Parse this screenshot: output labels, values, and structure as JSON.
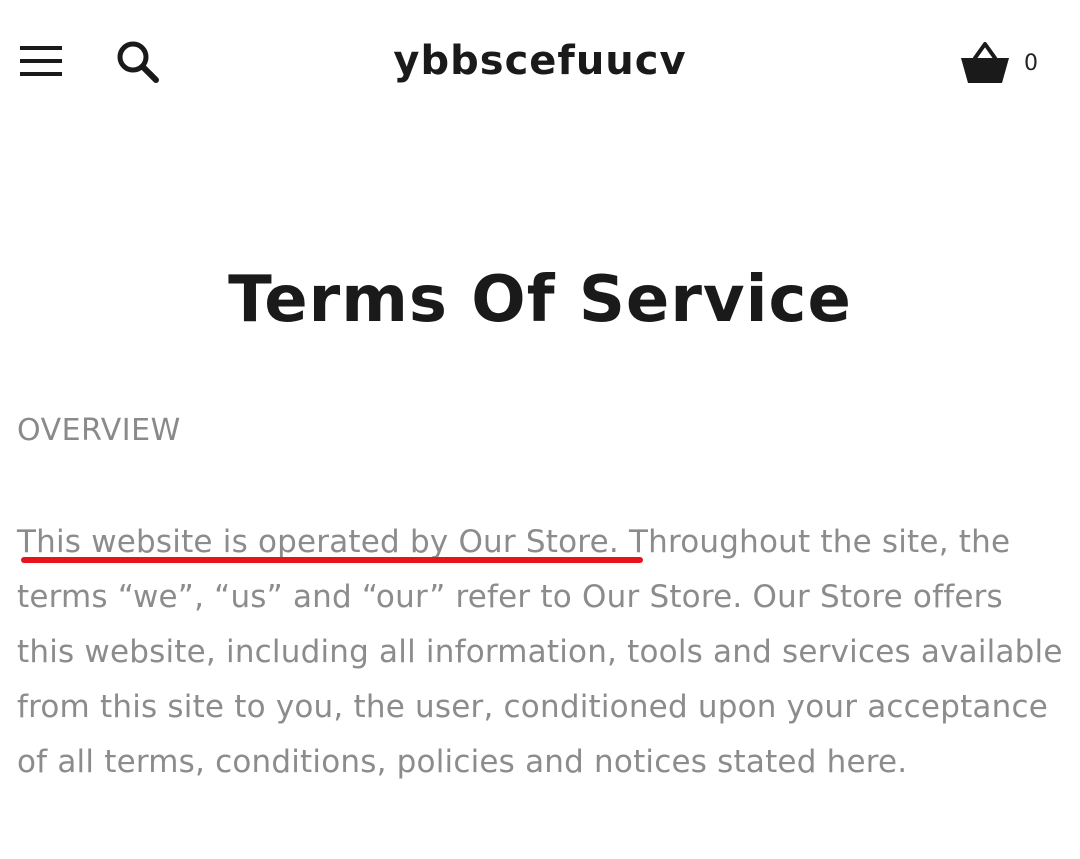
{
  "header": {
    "store_name": "ybbscefuucv",
    "cart_count": "0",
    "icons": {
      "menu": "hamburger-menu-icon",
      "search": "search-icon",
      "cart": "basket-icon"
    }
  },
  "page": {
    "title": "Terms Of Service",
    "section_heading": "OVERVIEW",
    "paragraph_highlight": "This website is operated by Our Store.",
    "paragraph_rest": " Throughout the site, the terms “we”, “us” and “our” refer to Our Store. Our Store offers this website, including all information, tools and services available from this site to you, the user, conditioned upon your acceptance of all terms, conditions, policies and notices stated here."
  },
  "colors": {
    "annotation_underline": "#e8141c",
    "body_text": "#8c8c8c",
    "heading_text": "#1a1a1a"
  }
}
